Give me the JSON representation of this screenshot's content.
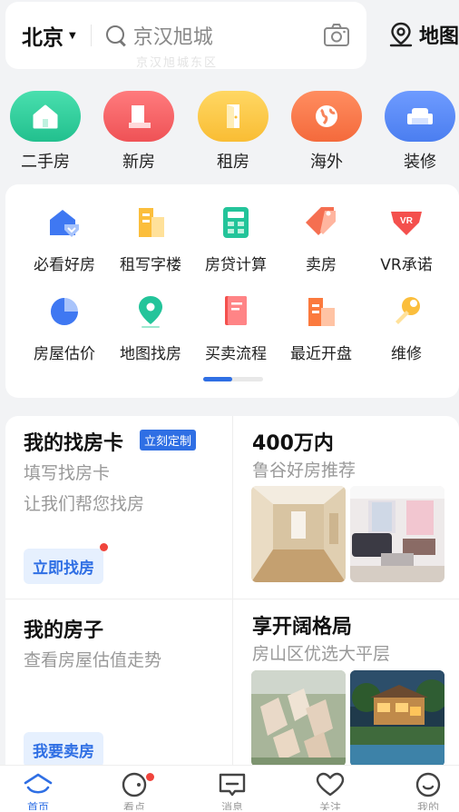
{
  "search": {
    "city": "北京",
    "placeholder": "京汉旭城",
    "ghost_text": "京汉旭城东区"
  },
  "map_entry": {
    "label": "地图"
  },
  "categories": [
    {
      "label": "二手房",
      "color": "#2fcf9e",
      "icon": "house-icon"
    },
    {
      "label": "新房",
      "color": "#f5666a",
      "icon": "building-icon"
    },
    {
      "label": "租房",
      "color": "#fdc94a",
      "icon": "door-icon"
    },
    {
      "label": "海外",
      "color": "#fb7a4b",
      "icon": "globe-icon"
    },
    {
      "label": "装修",
      "color": "#5b8df7",
      "icon": "sofa-icon"
    }
  ],
  "tools": {
    "row1": [
      {
        "label": "必看好房",
        "icon": "house-badge-icon"
      },
      {
        "label": "租写字楼",
        "icon": "office-building-icon"
      },
      {
        "label": "房贷计算",
        "icon": "calculator-icon"
      },
      {
        "label": "卖房",
        "icon": "price-tag-icon"
      },
      {
        "label": "VR承诺",
        "icon": "vr-shield-icon"
      }
    ],
    "row2": [
      {
        "label": "房屋估价",
        "icon": "pie-chart-icon"
      },
      {
        "label": "地图找房",
        "icon": "map-pin-icon"
      },
      {
        "label": "买卖流程",
        "icon": "document-icon"
      },
      {
        "label": "最近开盘",
        "icon": "sale-building-icon"
      },
      {
        "label": "维修",
        "icon": "wrench-icon"
      }
    ]
  },
  "cards": {
    "find_card": {
      "title": "我的找房卡",
      "tag": "立刻定制",
      "sub1": "填写找房卡",
      "sub2": "让我们帮您找房",
      "button": "立即找房"
    },
    "budget": {
      "title": "400万内",
      "sub": "鲁谷好房推荐"
    },
    "my_house": {
      "title": "我的房子",
      "sub": "查看房屋估值走势",
      "button": "我要卖房"
    },
    "open_layout": {
      "title": "享开阔格局",
      "sub": "房山区优选大平层"
    }
  },
  "nav": [
    {
      "label": "首页",
      "icon": "home-icon",
      "active": true
    },
    {
      "label": "看点",
      "icon": "discover-icon",
      "active": false
    },
    {
      "label": "消息",
      "icon": "message-icon",
      "active": false
    },
    {
      "label": "关注",
      "icon": "heart-icon",
      "active": false
    },
    {
      "label": "我的",
      "icon": "profile-icon",
      "active": false
    }
  ],
  "colors": {
    "accent": "#2f6fe4",
    "badge_red": "#f0443c"
  }
}
